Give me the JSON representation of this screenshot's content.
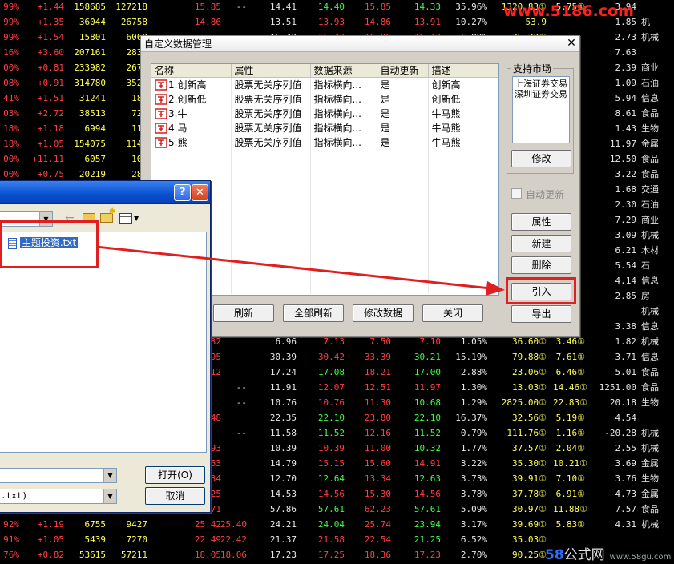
{
  "background_table": {
    "rows": [
      {
        "pct": "99%",
        "chg": "+1.44",
        "v1": "158685",
        "v2": "127218",
        "c1": "15.85",
        "c2": "--",
        "c3": "14.41",
        "c4": "14.40",
        "c5": "15.85",
        "c6": "14.33",
        "c7": "35.96%",
        "c8": "1320.83①",
        "c9": "5.75①",
        "c10": "3.94",
        "c11": ""
      },
      {
        "pct": "99%",
        "chg": "+1.35",
        "v1": "36044",
        "v2": "26758",
        "c1": "14.86",
        "c2": "",
        "c3": "13.51",
        "c4": "13.93",
        "c5": "14.86",
        "c6": "13.91",
        "c7": "10.27%",
        "c8": "53.9",
        "c9": "",
        "c10": "1.85",
        "c11": "机"
      },
      {
        "pct": "99%",
        "chg": "+1.54",
        "v1": "15801",
        "v2": "6060",
        "c1": "",
        "c2": "",
        "c3": "15.42",
        "c4": "15.43",
        "c5": "16.96",
        "c6": "15.43",
        "c7": "6.89%",
        "c8": "35.32①",
        "c9": "",
        "c10": "2.73",
        "c11": "机械"
      },
      {
        "pct": "16%",
        "chg": "+3.60",
        "v1": "207161",
        "v2": "2835",
        "c1": "",
        "c2": "",
        "c3": "",
        "c4": "",
        "c5": "",
        "c6": "",
        "c7": "",
        "c8": "",
        "c9": "",
        "c10": "7.63",
        "c11": ""
      },
      {
        "pct": "00%",
        "chg": "+0.81",
        "v1": "233982",
        "v2": "2676",
        "c1": "",
        "c2": "",
        "c3": "",
        "c4": "",
        "c5": "",
        "c6": "",
        "c7": "",
        "c8": "",
        "c9": "",
        "c10": "2.39",
        "c11": "商业"
      },
      {
        "pct": "08%",
        "chg": "+0.91",
        "v1": "314780",
        "v2": "3527",
        "c1": "",
        "c2": "",
        "c3": "",
        "c4": "",
        "c5": "",
        "c6": "",
        "c7": "",
        "c8": "",
        "c9": "",
        "c10": "1.09",
        "c11": "石油"
      },
      {
        "pct": "41%",
        "chg": "+1.51",
        "v1": "31241",
        "v2": "186",
        "c1": "",
        "c2": "",
        "c3": "",
        "c4": "",
        "c5": "",
        "c6": "",
        "c7": "",
        "c8": "",
        "c9": "",
        "c10": "5.94",
        "c11": "信息"
      },
      {
        "pct": "03%",
        "chg": "+2.72",
        "v1": "38513",
        "v2": "722",
        "c1": "",
        "c2": "",
        "c3": "",
        "c4": "",
        "c5": "",
        "c6": "",
        "c7": "",
        "c8": "",
        "c9": "",
        "c10": "8.61",
        "c11": "食品"
      },
      {
        "pct": "18%",
        "chg": "+1.18",
        "v1": "6994",
        "v2": "111",
        "c1": "",
        "c2": "",
        "c3": "",
        "c4": "",
        "c5": "",
        "c6": "",
        "c7": "",
        "c8": "",
        "c9": "",
        "c10": "1.43",
        "c11": "生物"
      },
      {
        "pct": "18%",
        "chg": "+1.05",
        "v1": "154075",
        "v2": "1143",
        "c1": "",
        "c2": "",
        "c3": "",
        "c4": "",
        "c5": "",
        "c6": "",
        "c7": "",
        "c8": "",
        "c9": "",
        "c10": "11.97",
        "c11": "金属"
      },
      {
        "pct": "00%",
        "chg": "+11.11",
        "v1": "6057",
        "v2": "103",
        "c1": "",
        "c2": "",
        "c3": "",
        "c4": "",
        "c5": "",
        "c6": "",
        "c7": "",
        "c8": "",
        "c9": "",
        "c10": "12.50",
        "c11": "食品"
      },
      {
        "pct": "00%",
        "chg": "+0.75",
        "v1": "20219",
        "v2": "289",
        "c1": "",
        "c2": "",
        "c3": "",
        "c4": "",
        "c5": "",
        "c6": "",
        "c7": "",
        "c8": "",
        "c9": "",
        "c10": "3.22",
        "c11": "食品"
      },
      {
        "pct": "09%",
        "chg": "+0.55",
        "v1": "133671",
        "v2": "443",
        "c1": "",
        "c2": "",
        "c3": "",
        "c4": "",
        "c5": "",
        "c6": "",
        "c7": "",
        "c8": "",
        "c9": "",
        "c10": "1.68",
        "c11": "交通"
      },
      {
        "pct": "",
        "chg": "",
        "v1": "",
        "v2": "",
        "c1": "",
        "c2": "",
        "c3": "",
        "c4": "",
        "c5": "",
        "c6": "",
        "c7": "",
        "c8": "",
        "c9": "",
        "c10": "2.30",
        "c11": "石油"
      },
      {
        "pct": "",
        "chg": "",
        "v1": "",
        "v2": "",
        "c1": "",
        "c2": "",
        "c3": "",
        "c4": "",
        "c5": "",
        "c6": "",
        "c7": "",
        "c8": "",
        "c9": "",
        "c10": "7.29",
        "c11": "商业"
      },
      {
        "pct": "",
        "chg": "",
        "v1": "",
        "v2": "",
        "c1": "",
        "c2": "",
        "c3": "",
        "c4": "",
        "c5": "",
        "c6": "",
        "c7": "",
        "c8": "",
        "c9": "",
        "c10": "3.09",
        "c11": "机械"
      },
      {
        "pct": "",
        "chg": "",
        "v1": "",
        "v2": "",
        "c1": "",
        "c2": "",
        "c3": "",
        "c4": "",
        "c5": "",
        "c6": "",
        "c7": "",
        "c8": "",
        "c9": "",
        "c10": "6.21",
        "c11": "木材"
      },
      {
        "pct": "",
        "chg": "",
        "v1": "",
        "v2": "",
        "c1": "",
        "c2": "",
        "c3": "",
        "c4": "",
        "c5": "",
        "c6": "",
        "c7": "",
        "c8": "",
        "c9": "",
        "c10": "5.54",
        "c11": "石"
      },
      {
        "pct": "",
        "chg": "",
        "v1": "",
        "v2": "",
        "c1": "",
        "c2": "",
        "c3": "",
        "c4": "",
        "c5": "",
        "c6": "",
        "c7": "",
        "c8": "",
        "c9": "",
        "c10": "4.14",
        "c11": "信息"
      },
      {
        "pct": "",
        "chg": "",
        "v1": "",
        "v2": "",
        "c1": "",
        "c2": "",
        "c3": "",
        "c4": "",
        "c5": "",
        "c6": "",
        "c7": "",
        "c8": "",
        "c9": "",
        "c10": "2.85",
        "c11": "房"
      },
      {
        "pct": "",
        "chg": "",
        "v1": "",
        "v2": "",
        "c1": "",
        "c2": "",
        "c3": "",
        "c4": "",
        "c5": "",
        "c6": "",
        "c7": "",
        "c8": "",
        "c9": "",
        "c10": "",
        "c11": "机械"
      },
      {
        "pct": "",
        "chg": "",
        "v1": "",
        "v2": "",
        "c1": "",
        "c2": "",
        "c3": "",
        "c4": "",
        "c5": "",
        "c6": "",
        "c7": "",
        "c8": "",
        "c9": "",
        "c10": "3.38",
        "c11": "信息"
      },
      {
        "pct": "",
        "chg": "",
        "v1": "",
        "v2": "",
        "c1": "7.32",
        "c2": "",
        "c3": "6.96",
        "c4": "7.13",
        "c5": "7.50",
        "c6": "7.10",
        "c7": "1.05%",
        "c8": "36.60①",
        "c9": "3.46①",
        "c10": "1.82",
        "c11": "机械"
      },
      {
        "pct": "",
        "chg": "",
        "v1": "",
        "v2": "",
        "c1": "31.95",
        "c2": "",
        "c3": "30.39",
        "c4": "30.42",
        "c5": "33.39",
        "c6": "30.21",
        "c7": "15.19%",
        "c8": "79.88①",
        "c9": "7.61①",
        "c10": "3.71",
        "c11": "信息"
      },
      {
        "pct": "",
        "chg": "",
        "v1": "",
        "v2": "",
        "c1": "18.12",
        "c2": "",
        "c3": "17.24",
        "c4": "17.08",
        "c5": "18.21",
        "c6": "17.00",
        "c7": "2.88%",
        "c8": "23.06①",
        "c9": "6.46①",
        "c10": "5.01",
        "c11": "食品"
      },
      {
        "pct": "",
        "chg": "",
        "v1": "",
        "v2": "",
        "c1": "",
        "c2": "--",
        "c3": "11.91",
        "c4": "12.07",
        "c5": "12.51",
        "c6": "11.97",
        "c7": "1.30%",
        "c8": "13.03①",
        "c9": "14.46①",
        "c10": "1251.00",
        "c11": "食品"
      },
      {
        "pct": "",
        "chg": "",
        "v1": "",
        "v2": "",
        "c1": "",
        "c2": "--",
        "c3": "10.76",
        "c4": "10.76",
        "c5": "11.30",
        "c6": "10.68",
        "c7": "1.29%",
        "c8": "2825.00①",
        "c9": "22.83①",
        "c10": "20.18",
        "c11": "生物"
      },
      {
        "pct": "",
        "chg": "",
        "v1": "",
        "v2": "",
        "c1": "23.48",
        "c2": "",
        "c3": "22.35",
        "c4": "22.10",
        "c5": "23.80",
        "c6": "22.10",
        "c7": "16.37%",
        "c8": "32.56①",
        "c9": "5.19①",
        "c10": "4.54",
        "c11": ""
      },
      {
        "pct": "",
        "chg": "",
        "v1": "",
        "v2": "",
        "c1": "",
        "c2": "--",
        "c3": "11.58",
        "c4": "11.52",
        "c5": "12.16",
        "c6": "11.52",
        "c7": "0.79%",
        "c8": "111.76①",
        "c9": "1.16①",
        "c10": "-20.28",
        "c11": "机械"
      },
      {
        "pct": "",
        "chg": "",
        "v1": "",
        "v2": "",
        "c1": "10.93",
        "c2": "",
        "c3": "10.39",
        "c4": "10.39",
        "c5": "11.00",
        "c6": "10.32",
        "c7": "1.77%",
        "c8": "37.57①",
        "c9": "2.04①",
        "c10": "2.55",
        "c11": "机械"
      },
      {
        "pct": "",
        "chg": "",
        "v1": "",
        "v2": "",
        "c1": "15.53",
        "c2": "",
        "c3": "14.79",
        "c4": "15.15",
        "c5": "15.60",
        "c6": "14.91",
        "c7": "3.22%",
        "c8": "35.30①",
        "c9": "10.21①",
        "c10": "3.69",
        "c11": "金属"
      },
      {
        "pct": "",
        "chg": "",
        "v1": "",
        "v2": "",
        "c1": "13.34",
        "c2": "",
        "c3": "12.70",
        "c4": "12.64",
        "c5": "13.34",
        "c6": "12.63",
        "c7": "3.73%",
        "c8": "39.91①",
        "c9": "7.10①",
        "c10": "3.76",
        "c11": "生物"
      },
      {
        "pct": "",
        "chg": "",
        "v1": "",
        "v2": "",
        "c1": "15.25",
        "c2": "",
        "c3": "14.53",
        "c4": "14.56",
        "c5": "15.30",
        "c6": "14.56",
        "c7": "3.78%",
        "c8": "37.78①",
        "c9": "6.91①",
        "c10": "4.73",
        "c11": "金属"
      },
      {
        "pct": "",
        "chg": "",
        "v1": "",
        "v2": "",
        "c1": "60.71",
        "c2": "",
        "c3": "57.86",
        "c4": "57.61",
        "c5": "62.23",
        "c6": "57.61",
        "c7": "5.09%",
        "c8": "30.97①",
        "c9": "11.88①",
        "c10": "7.57",
        "c11": "食品"
      },
      {
        "pct": "92%",
        "chg": "+1.19",
        "v1": "6755",
        "v2": "9427",
        "c1": "25.42",
        "c2": "25.40",
        "c3": "24.21",
        "c4": "24.04",
        "c5": "25.74",
        "c6": "23.94",
        "c7": "3.17%",
        "c8": "39.69①",
        "c9": "5.83①",
        "c10": "4.31",
        "c11": "机械"
      },
      {
        "pct": "91%",
        "chg": "+1.05",
        "v1": "5439",
        "v2": "7270",
        "c1": "22.49",
        "c2": "22.42",
        "c3": "21.37",
        "c4": "21.58",
        "c5": "22.54",
        "c6": "21.25",
        "c7": "6.52%",
        "c8": "35.03①",
        "c9": "",
        "c10": "",
        "c11": ""
      },
      {
        "pct": "76%",
        "chg": "+0.82",
        "v1": "53615",
        "v2": "57211",
        "c1": "18.05",
        "c2": "18.06",
        "c3": "17.23",
        "c4": "17.25",
        "c5": "18.36",
        "c6": "17.23",
        "c7": "2.70%",
        "c8": "90.25①",
        "c9": "",
        "c10": "",
        "c11": ""
      }
    ]
  },
  "watermark_top": "www.5186.com",
  "watermark_bottom": {
    "num": "58",
    "text": "公式网",
    "url": "www.58gu.com"
  },
  "main_dialog": {
    "title": "自定义数据管理",
    "columns": [
      "名称",
      "属性",
      "数据来源",
      "自动更新",
      "描述"
    ],
    "rows": [
      {
        "name": "1.创新高",
        "attr": "股票无关序列值",
        "source": "指标横向...",
        "auto": "是",
        "desc": "创新高"
      },
      {
        "name": "2.创新低",
        "attr": "股票无关序列值",
        "source": "指标横向...",
        "auto": "是",
        "desc": "创新低"
      },
      {
        "name": "3.牛",
        "attr": "股票无关序列值",
        "source": "指标横向...",
        "auto": "是",
        "desc": "牛马熊"
      },
      {
        "name": "4.马",
        "attr": "股票无关序列值",
        "source": "指标横向...",
        "auto": "是",
        "desc": "牛马熊"
      },
      {
        "name": "5.熊",
        "attr": "股票无关序列值",
        "source": "指标横向...",
        "auto": "是",
        "desc": "牛马熊"
      }
    ],
    "market_group_label": "支持市场",
    "markets": [
      "上海证券交易",
      "深圳证券交易"
    ],
    "modify_market_btn": "修改",
    "auto_update_label": "自动更新",
    "btn_property": "属性",
    "btn_new": "新建",
    "btn_delete": "删除",
    "btn_import": "引入",
    "btn_export": "导出",
    "btn_refresh": "刷新",
    "btn_refresh_all": "全部刷新",
    "btn_modify_data": "修改数据",
    "btn_close": "关闭"
  },
  "file_dialog": {
    "help_glyph": "?",
    "close_glyph": "✕",
    "file_item": "主题投资.txt",
    "filetype_value": ".txt)",
    "open_btn": "打开(O)",
    "cancel_btn": "取消"
  },
  "colors": {
    "red": "#ff3c3c",
    "green": "#3cff3c",
    "yellow": "#ffff55",
    "white": "#e8e8e8",
    "accent": "#e02020"
  }
}
